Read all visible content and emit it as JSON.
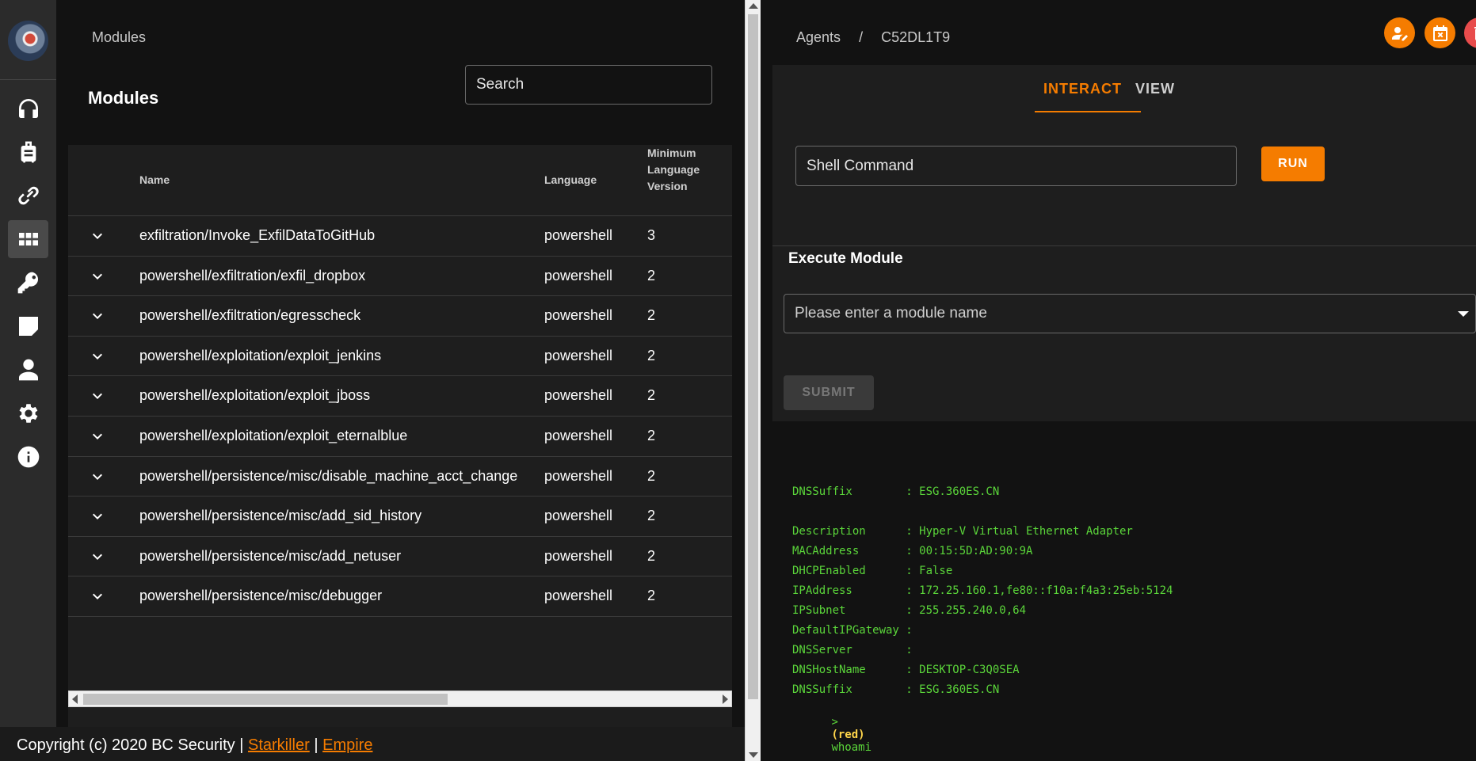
{
  "sidebar": {
    "items": [
      {
        "name": "headphones-icon",
        "active": false
      },
      {
        "name": "luggage-icon",
        "active": false
      },
      {
        "name": "link-icon",
        "active": false
      },
      {
        "name": "grid-icon",
        "active": true
      },
      {
        "name": "key-icon",
        "active": false
      },
      {
        "name": "sticky-note-icon",
        "active": false
      },
      {
        "name": "user-icon",
        "active": false
      },
      {
        "name": "gear-icon",
        "active": false
      },
      {
        "name": "info-icon",
        "active": false
      }
    ]
  },
  "left": {
    "breadcrumb": "Modules",
    "title": "Modules",
    "search_placeholder": "Search",
    "table": {
      "headers": {
        "name": "Name",
        "language": "Language",
        "min_version": [
          "Minimum",
          "Language",
          "Version"
        ]
      },
      "rows": [
        {
          "name": "exfiltration/Invoke_ExfilDataToGitHub",
          "language": "powershell",
          "version": "3"
        },
        {
          "name": "powershell/exfiltration/exfil_dropbox",
          "language": "powershell",
          "version": "2"
        },
        {
          "name": "powershell/exfiltration/egresscheck",
          "language": "powershell",
          "version": "2"
        },
        {
          "name": "powershell/exploitation/exploit_jenkins",
          "language": "powershell",
          "version": "2"
        },
        {
          "name": "powershell/exploitation/exploit_jboss",
          "language": "powershell",
          "version": "2"
        },
        {
          "name": "powershell/exploitation/exploit_eternalblue",
          "language": "powershell",
          "version": "2"
        },
        {
          "name": "powershell/persistence/misc/disable_machine_acct_change",
          "language": "powershell",
          "version": "2"
        },
        {
          "name": "powershell/persistence/misc/add_sid_history",
          "language": "powershell",
          "version": "2"
        },
        {
          "name": "powershell/persistence/misc/add_netuser",
          "language": "powershell",
          "version": "2"
        },
        {
          "name": "powershell/persistence/misc/debugger",
          "language": "powershell",
          "version": "2"
        }
      ]
    }
  },
  "footer": {
    "copyright": "Copyright (c) 2020 BC Security |",
    "link1": "Starkiller",
    "sep": "|",
    "link2": "Empire"
  },
  "right": {
    "breadcrumb": {
      "root": "Agents",
      "sep": "/",
      "agent": "C52DL1T9"
    },
    "top_buttons": [
      {
        "name": "edit-user-icon",
        "color": "#f57c00"
      },
      {
        "name": "clear-tasks-icon",
        "color": "#f57c00"
      },
      {
        "name": "delete-icon",
        "color": "#e84c4c"
      }
    ],
    "tabs": {
      "interact": "INTERACT",
      "view": "VIEW"
    },
    "shell_placeholder": "Shell Command",
    "run_label": "RUN",
    "execute_module_title": "Execute Module",
    "module_placeholder": "Please enter a module name",
    "submit_label": "SUBMIT",
    "terminal": {
      "lines": [
        "DNSSuffix        : ESG.360ES.CN",
        "",
        "Description      : Hyper-V Virtual Ethernet Adapter",
        "MACAddress       : 00:15:5D:AD:90:9A",
        "DHCPEnabled      : False",
        "IPAddress        : 172.25.160.1,fe80::f10a:f4a3:25eb:5124",
        "IPSubnet         : 255.255.240.0,64",
        "DefaultIPGateway :",
        "DNSServer        :",
        "DNSHostName      : DESKTOP-C3Q0SEA",
        "DNSSuffix        : ESG.360ES.CN"
      ],
      "prompt": {
        "gt": ">",
        "agent": "(red)",
        "command": "whoami"
      }
    }
  },
  "colors": {
    "accent": "#f57c00",
    "danger": "#e84c4c",
    "terminal_green": "#5bd63a"
  }
}
